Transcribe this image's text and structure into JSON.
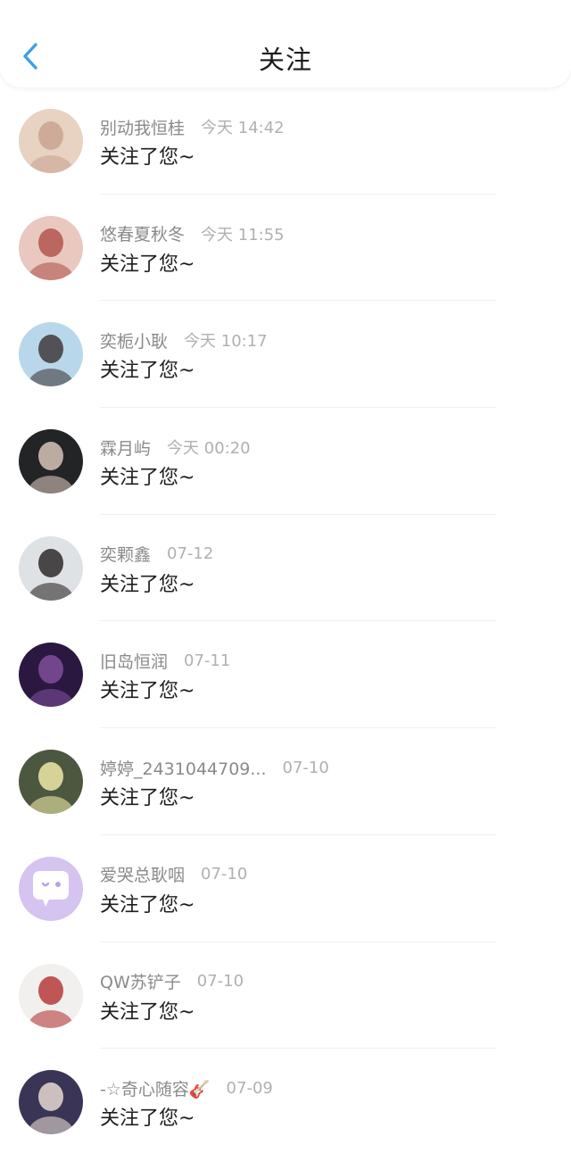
{
  "header": {
    "title": "关注"
  },
  "notifications": [
    {
      "name": "别动我恒桂",
      "time": "今天 14:42",
      "message": "关注了您~",
      "avatar_icon": "avatar-photo-girl-with-cat",
      "bg": "#e8d2c2",
      "fg": "#c9a592"
    },
    {
      "name": "悠春夏秋冬",
      "time": "今天 11:55",
      "message": "关注了您~",
      "avatar_icon": "avatar-photo-girl-red-heart",
      "bg": "#e9c8c0",
      "fg": "#b3554e"
    },
    {
      "name": "奕栀小耿",
      "time": "今天 10:17",
      "message": "关注了您~",
      "avatar_icon": "avatar-photo-girl-hat",
      "bg": "#b9d7ea",
      "fg": "#3f3a3c"
    },
    {
      "name": "霖月屿",
      "time": "今天 00:20",
      "message": "关注了您~",
      "avatar_icon": "avatar-photo-man-dark",
      "bg": "#222426",
      "fg": "#d7c3b7"
    },
    {
      "name": "奕颗鑫",
      "time": "07-12",
      "message": "关注了您~",
      "avatar_icon": "avatar-photo-two-people",
      "bg": "#dfe2e4",
      "fg": "#2e2a2a"
    },
    {
      "name": "旧岛恒润",
      "time": "07-11",
      "message": "关注了您~",
      "avatar_icon": "avatar-photo-night-blur",
      "bg": "#2a1840",
      "fg": "#7f4d9b"
    },
    {
      "name": "婷婷_2431044709...",
      "time": "07-10",
      "message": "关注了您~",
      "avatar_icon": "avatar-photo-flowers",
      "bg": "#4c5740",
      "fg": "#efe8a8"
    },
    {
      "name": "爱哭总耿咽",
      "time": "07-10",
      "message": "关注了您~",
      "avatar_icon": "avatar-default-chat-bubble",
      "bg": "#d5c3f0",
      "fg": "#ffffff"
    },
    {
      "name": "QW苏铲子",
      "time": "07-10",
      "message": "关注了您~",
      "avatar_icon": "avatar-photo-cartoon-boy",
      "bg": "#f1f0ee",
      "fg": "#b63a3a"
    },
    {
      "name": "-☆奇心随容🎸",
      "time": "07-09",
      "message": "关注了您~",
      "avatar_icon": "avatar-photo-boy-suit",
      "bg": "#3a3556",
      "fg": "#e6d8d0"
    }
  ]
}
